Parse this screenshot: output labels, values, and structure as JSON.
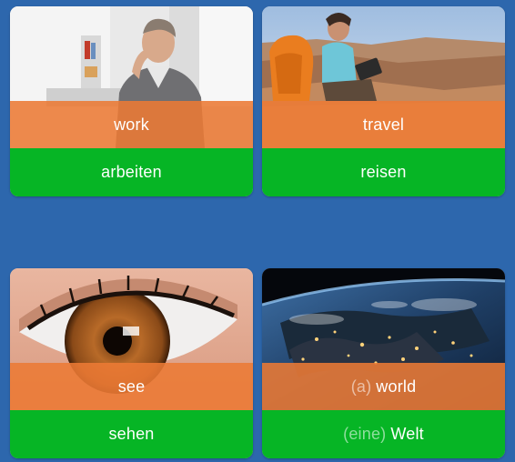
{
  "colors": {
    "background": "#2d67ad",
    "english_band": "#ec7a34",
    "german_band": "#06b525",
    "text": "#ffffff"
  },
  "cards": [
    {
      "image_icon": "man-working-photo",
      "english": {
        "article": "",
        "word": "work"
      },
      "german": {
        "article": "",
        "word": "arbeiten"
      }
    },
    {
      "image_icon": "hiker-canyon-photo",
      "english": {
        "article": "",
        "word": "travel"
      },
      "german": {
        "article": "",
        "word": "reisen"
      }
    },
    {
      "image_icon": "eye-photo",
      "english": {
        "article": "",
        "word": "see"
      },
      "german": {
        "article": "",
        "word": "sehen"
      }
    },
    {
      "image_icon": "earth-from-space-photo",
      "english": {
        "article": "(a)",
        "word": "world"
      },
      "german": {
        "article": "(eine)",
        "word": "Welt"
      }
    }
  ]
}
